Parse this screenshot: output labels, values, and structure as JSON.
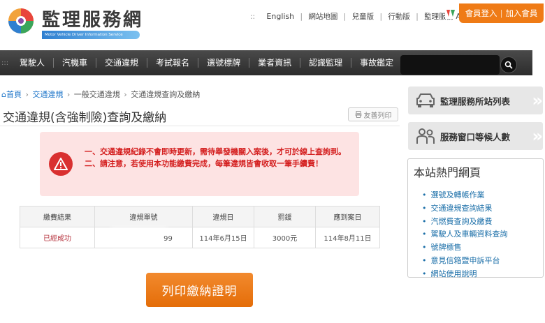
{
  "header": {
    "brand_name": "監理服務網",
    "brand_sub": "Motor Vehicle Driver Information Service",
    "top_links": [
      "English",
      "網站地圖",
      "兒童版",
      "行動版",
      "監理服務 APP"
    ],
    "member_login": "會員登入",
    "join_member": "加入會員"
  },
  "nav": {
    "items": [
      "駕駛人",
      "汽機車",
      "交通違規",
      "考試報名",
      "選號標牌",
      "業者資訊",
      "認識監理",
      "事故鑑定"
    ],
    "search_placeholder": ""
  },
  "breadcrumb": {
    "home": "首頁",
    "level1": "交通違規",
    "level2": "一般交通違規",
    "current": "交通違規查詢及繳納"
  },
  "page": {
    "title": "交通違規(含強制險)查詢及繳納",
    "print_friendly": "友善列印"
  },
  "warning": {
    "line1": "一、交通違規紀錄不會即時更新，需待舉發機關入案後，才可於線上查詢到。",
    "line2": "二、請注意，若使用本功能繳費完成，每筆違規皆會收取一筆手續費！"
  },
  "result_table": {
    "headers": [
      "繳費結果",
      "違規單號",
      "違規日",
      "罰鍰",
      "應到案日"
    ],
    "rows": [
      [
        "已經成功",
        "99",
        "114年6月15日",
        "3000元",
        "114年8月11日"
      ]
    ]
  },
  "print_certificate": "列印繳納證明",
  "sidebar": {
    "station_list": "監理服務所站列表",
    "queue_count": "服務窗口等候人數",
    "hot_title": "本站熱門網頁",
    "hot_links": [
      "選號及轉帳作業",
      "交通違規查詢結果",
      "汽燃費查詢及繳費",
      "駕駛人及車輛資料查詢",
      "號牌標售",
      "意見信箱暨申訴平台",
      "網站使用說明"
    ]
  },
  "colors": {
    "accent_orange": "#ef7b16",
    "nav_dark": "#333333",
    "warning_bg": "#fde3e3",
    "warning_text": "#d42020",
    "link_blue": "#1a73c8"
  }
}
